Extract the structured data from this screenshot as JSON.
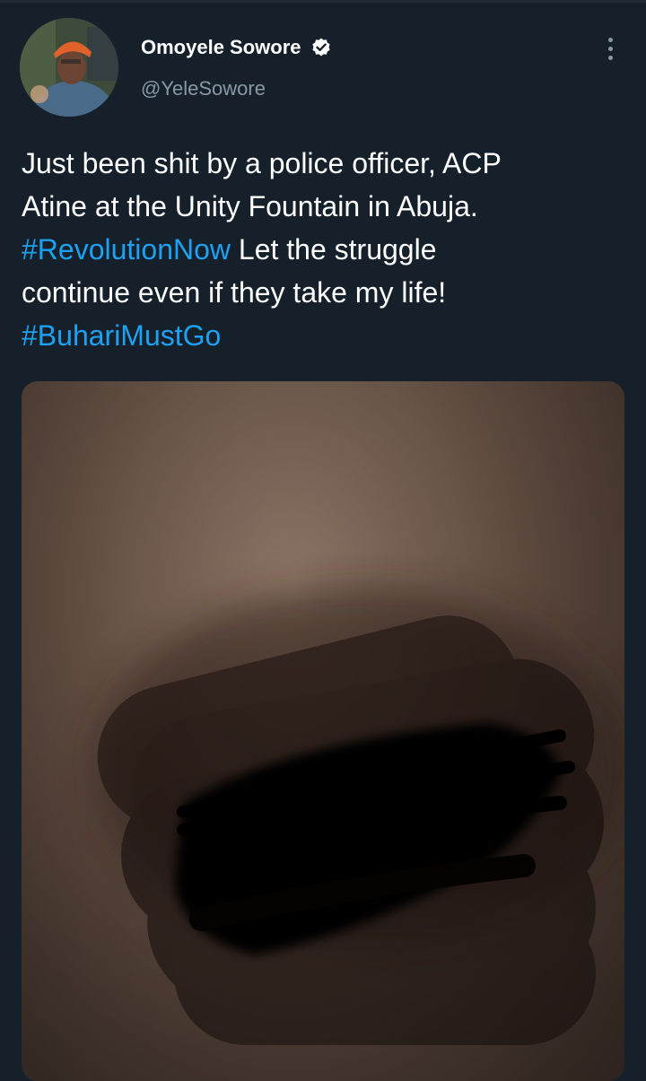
{
  "user": {
    "display_name": "Omoyele Sowore",
    "handle": "@YeleSowore",
    "verified_icon": "verified-badge-icon"
  },
  "tweet": {
    "line1": "Just been shit by a police officer, ACP",
    "line2": "Atine at the Unity Fountain in Abuja.",
    "hashtag1": "#RevolutionNow",
    "line3_rest": " Let the struggle",
    "line4": "continue even if they take my life!",
    "hashtag2": "#BuhariMustGo"
  },
  "menu": {
    "icon": "more-vertical-icon"
  },
  "colors": {
    "background": "#15202b",
    "text": "#ffffff",
    "secondary": "#8899a6",
    "link": "#1da1f2"
  }
}
